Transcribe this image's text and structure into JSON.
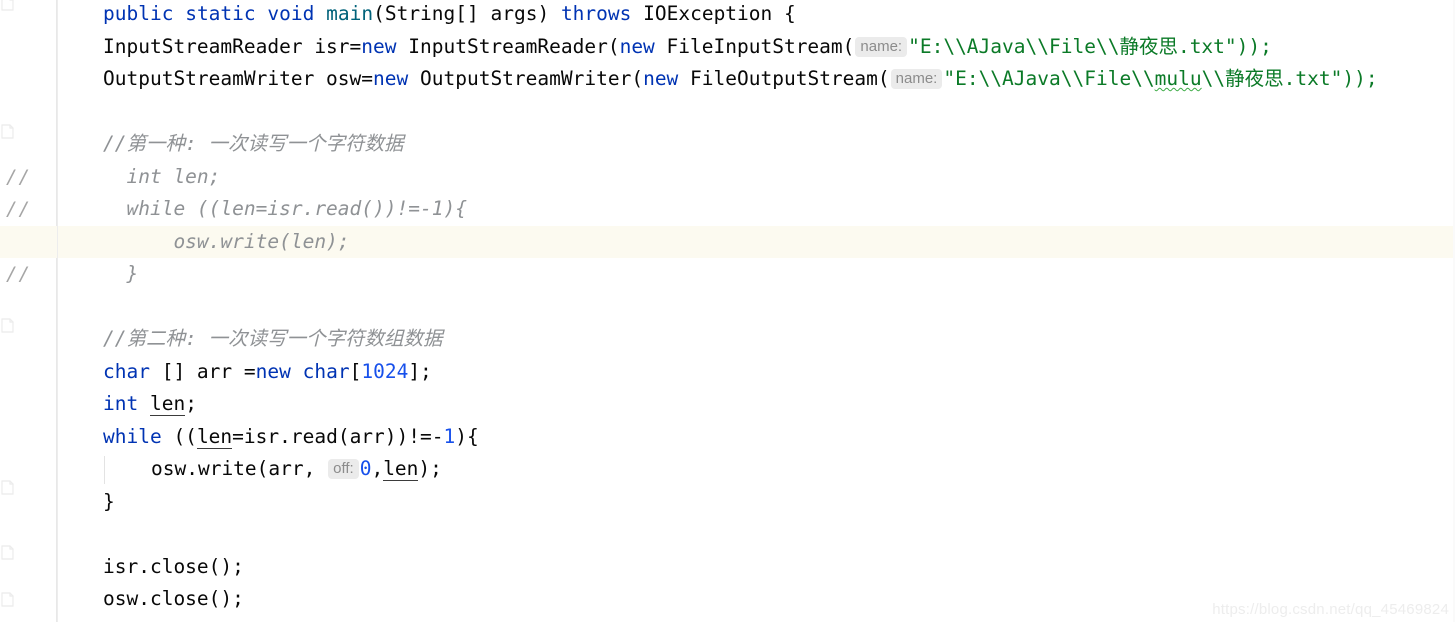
{
  "editor": {
    "app": "code-editor",
    "language": "java",
    "line_height_px": 32.5,
    "colors": {
      "background": "#ffffff",
      "keyword": "#0033b3",
      "number": "#1750eb",
      "string": "#0b7a27",
      "method": "#00627a",
      "comment": "#8f9295",
      "identifier": "#080808",
      "current_line_highlight": "#fcfaf0",
      "hint_chip_background": "#ebebeb",
      "hint_chip_text": "#8c8c8c",
      "typo_underline": "#3cab45",
      "gutter_rule": "#e8e8e8",
      "indent_guide": "#e3e3e3",
      "watermark": "#ededed"
    },
    "gutter": {
      "comment_markers": [
        "//",
        "//",
        "//",
        "//"
      ],
      "fold_icon_name": "code-fold-icon"
    },
    "lines": [
      {
        "n": 1,
        "indent": 0,
        "tokens": [
          {
            "t": "public",
            "c": "kw"
          },
          {
            "t": " ",
            "c": "plain"
          },
          {
            "t": "static",
            "c": "kw"
          },
          {
            "t": " ",
            "c": "plain"
          },
          {
            "t": "void",
            "c": "kw"
          },
          {
            "t": " ",
            "c": "plain"
          },
          {
            "t": "main",
            "c": "meth"
          },
          {
            "t": "(String[] args) ",
            "c": "plain"
          },
          {
            "t": "throws",
            "c": "kw"
          },
          {
            "t": " IOException {",
            "c": "plain"
          }
        ]
      },
      {
        "n": 2,
        "indent": 1,
        "tokens": [
          {
            "t": "InputStreamReader isr=",
            "c": "plain"
          },
          {
            "t": "new",
            "c": "kw"
          },
          {
            "t": " InputStreamReader(",
            "c": "plain"
          },
          {
            "t": "new",
            "c": "kw"
          },
          {
            "t": " FileInputStream(",
            "c": "plain"
          },
          {
            "t": "name:",
            "c": "hint"
          },
          {
            "t": "\"E:\\\\AJava\\\\File\\\\静夜思.txt\"));",
            "c": "str"
          }
        ]
      },
      {
        "n": 3,
        "indent": 1,
        "tokens": [
          {
            "t": "OutputStreamWriter osw=",
            "c": "plain"
          },
          {
            "t": "new",
            "c": "kw"
          },
          {
            "t": " OutputStreamWriter(",
            "c": "plain"
          },
          {
            "t": "new",
            "c": "kw"
          },
          {
            "t": " FileOutputStream(",
            "c": "plain"
          },
          {
            "t": "name:",
            "c": "hint"
          },
          {
            "t": "\"E:\\\\AJava\\\\File\\\\",
            "c": "str"
          },
          {
            "t": "mulu",
            "c": "str-typo"
          },
          {
            "t": "\\\\静夜思.txt\"));",
            "c": "str"
          }
        ]
      },
      {
        "n": 4,
        "indent": 0,
        "tokens": []
      },
      {
        "n": 5,
        "indent": 1,
        "tokens": [
          {
            "t": "//第一种: 一次读写一个字符数据",
            "c": "cmt"
          }
        ]
      },
      {
        "n": 6,
        "indent": 1,
        "gutter": "//",
        "commented": true,
        "tokens": [
          {
            "t": "  int len;",
            "c": "cmt"
          }
        ]
      },
      {
        "n": 7,
        "indent": 1,
        "gutter": "//",
        "commented": true,
        "tokens": [
          {
            "t": "  while ((len=isr.read())!=-1){",
            "c": "cmt"
          }
        ]
      },
      {
        "n": 8,
        "indent": 1,
        "gutter": "//",
        "commented": true,
        "highlight": true,
        "tokens": [
          {
            "t": "      osw.write(len);",
            "c": "cmt"
          }
        ]
      },
      {
        "n": 9,
        "indent": 1,
        "gutter": "//",
        "commented": true,
        "tokens": [
          {
            "t": "  }",
            "c": "cmt"
          }
        ]
      },
      {
        "n": 10,
        "indent": 0,
        "tokens": []
      },
      {
        "n": 11,
        "indent": 1,
        "tokens": [
          {
            "t": "//第二种: 一次读写一个字符数组数据",
            "c": "cmt"
          }
        ]
      },
      {
        "n": 12,
        "indent": 1,
        "tokens": [
          {
            "t": "char",
            "c": "kw"
          },
          {
            "t": " [] arr =",
            "c": "plain"
          },
          {
            "t": "new",
            "c": "kw"
          },
          {
            "t": " ",
            "c": "plain"
          },
          {
            "t": "char",
            "c": "kw"
          },
          {
            "t": "[",
            "c": "plain"
          },
          {
            "t": "1024",
            "c": "num"
          },
          {
            "t": "];",
            "c": "plain"
          }
        ]
      },
      {
        "n": 13,
        "indent": 1,
        "tokens": [
          {
            "t": "int",
            "c": "kw"
          },
          {
            "t": " ",
            "c": "plain"
          },
          {
            "t": "len",
            "c": "plain-underline"
          },
          {
            "t": ";",
            "c": "plain"
          }
        ]
      },
      {
        "n": 14,
        "indent": 1,
        "tokens": [
          {
            "t": "while",
            "c": "kw"
          },
          {
            "t": " ((",
            "c": "plain"
          },
          {
            "t": "len",
            "c": "plain-underline"
          },
          {
            "t": "=isr.read(arr))!=-",
            "c": "plain"
          },
          {
            "t": "1",
            "c": "num"
          },
          {
            "t": "){",
            "c": "plain"
          }
        ]
      },
      {
        "n": 15,
        "indent": 2,
        "tokens": [
          {
            "t": "osw.write(arr, ",
            "c": "plain"
          },
          {
            "t": "off:",
            "c": "hint"
          },
          {
            "t": "0",
            "c": "num"
          },
          {
            "t": ",",
            "c": "plain"
          },
          {
            "t": "len",
            "c": "plain-underline"
          },
          {
            "t": ");",
            "c": "plain"
          }
        ]
      },
      {
        "n": 16,
        "indent": 1,
        "tokens": [
          {
            "t": "}",
            "c": "plain"
          }
        ]
      },
      {
        "n": 17,
        "indent": 0,
        "tokens": []
      },
      {
        "n": 18,
        "indent": 1,
        "tokens": [
          {
            "t": "isr.close();",
            "c": "plain"
          }
        ]
      },
      {
        "n": 19,
        "indent": 1,
        "tokens": [
          {
            "t": "osw.close();",
            "c": "plain"
          }
        ]
      }
    ],
    "watermark": "https://blog.csdn.net/qq_45469824"
  }
}
